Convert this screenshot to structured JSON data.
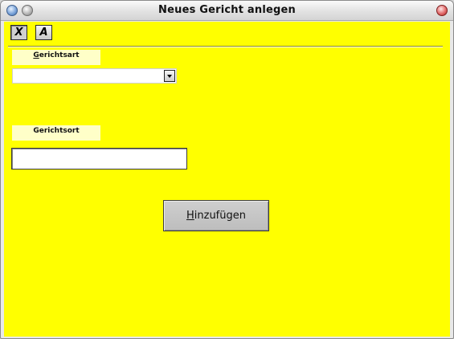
{
  "window": {
    "title": "Neues Gericht anlegen"
  },
  "toolbar": {
    "tool1_glyph": "X",
    "tool2_glyph": "A"
  },
  "form": {
    "gerichtsart": {
      "label_mnemonic": "G",
      "label_rest": "erichtsart",
      "selected_value": ""
    },
    "gerichtsort": {
      "label": "Gerichtsort",
      "value": ""
    },
    "submit": {
      "label_mnemonic": "H",
      "label_rest": "inzufügen"
    }
  },
  "colors": {
    "background": "#ffff00",
    "label_background": "#ffffc8",
    "button_face": "#c4c4c4"
  }
}
